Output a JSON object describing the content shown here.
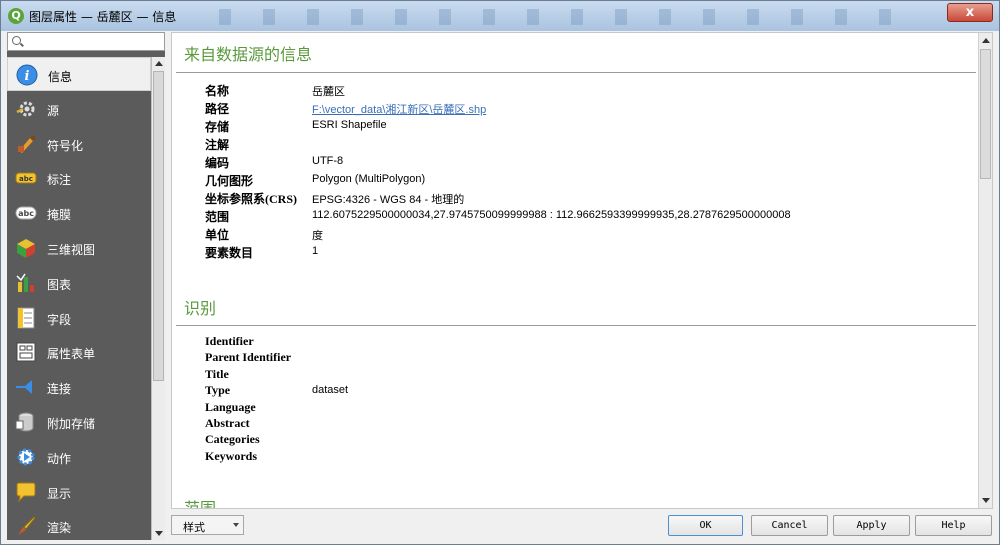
{
  "window": {
    "title": "图层属性 — 岳麓区 — 信息",
    "close_label": "x"
  },
  "sidebar": {
    "search_placeholder": "",
    "items": [
      {
        "label": "信息",
        "icon": "info-icon"
      },
      {
        "label": "源",
        "icon": "source-icon"
      },
      {
        "label": "符号化",
        "icon": "symbology-icon"
      },
      {
        "label": "标注",
        "icon": "labels-icon"
      },
      {
        "label": "掩膜",
        "icon": "mask-icon"
      },
      {
        "label": "三维视图",
        "icon": "3d-view-icon"
      },
      {
        "label": "图表",
        "icon": "diagram-icon"
      },
      {
        "label": "字段",
        "icon": "fields-icon"
      },
      {
        "label": "属性表单",
        "icon": "attribute-form-icon"
      },
      {
        "label": "连接",
        "icon": "joins-icon"
      },
      {
        "label": "附加存储",
        "icon": "auxiliary-storage-icon"
      },
      {
        "label": "动作",
        "icon": "actions-icon"
      },
      {
        "label": "显示",
        "icon": "display-icon"
      },
      {
        "label": "渲染",
        "icon": "rendering-icon"
      }
    ]
  },
  "content": {
    "section1_title": "来自数据源的信息",
    "info": [
      {
        "key": "名称",
        "value": "岳麓区"
      },
      {
        "key": "路径",
        "value": "F:\\vector_data\\湘江新区\\岳麓区.shp",
        "link": true
      },
      {
        "key": "存储",
        "value": "ESRI Shapefile"
      },
      {
        "key": "注解",
        "value": ""
      },
      {
        "key": "编码",
        "value": "UTF-8"
      },
      {
        "key": "几何图形",
        "value": "Polygon (MultiPolygon)"
      },
      {
        "key": "坐标参照系(CRS)",
        "value": "EPSG:4326 - WGS 84 - 地理的"
      },
      {
        "key": "范围",
        "value": "112.6075229500000034,27.9745750099999988 : 112.9662593399999935,28.2787629500000008"
      },
      {
        "key": "单位",
        "value": "度"
      },
      {
        "key": "要素数目",
        "value": "1"
      }
    ],
    "section2_title": "识别",
    "identification": [
      {
        "key": "Identifier",
        "value": ""
      },
      {
        "key": "Parent Identifier",
        "value": ""
      },
      {
        "key": "Title",
        "value": ""
      },
      {
        "key": "Type",
        "value": "dataset"
      },
      {
        "key": "Language",
        "value": ""
      },
      {
        "key": "Abstract",
        "value": ""
      },
      {
        "key": "Categories",
        "value": ""
      },
      {
        "key": "Keywords",
        "value": ""
      }
    ],
    "section3_title": "范围"
  },
  "footer": {
    "style_label": "样式",
    "ok_label": "OK",
    "cancel_label": "Cancel",
    "apply_label": "Apply",
    "help_label": "Help"
  },
  "colors": {
    "accent_green": "#5a9a3c",
    "link_blue": "#3a6fb8",
    "sidebar_bg": "#5b5b5b"
  }
}
